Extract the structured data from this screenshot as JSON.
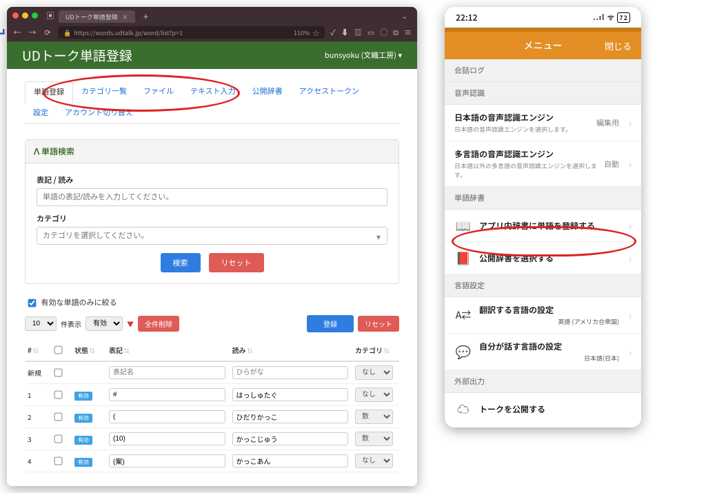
{
  "browser": {
    "tab_title": "UDトーク単語登録",
    "url": "https://words.udtalk.jp/word/list?p=1",
    "zoom": "110%",
    "banner_title": "UDトーク単語登録",
    "user_label": "bunsyoku (文織工房) ▾",
    "nav": {
      "word_reg": "単語登録",
      "categories": "カテゴリ一覧",
      "file": "ファイル",
      "text_input": "テキスト入力",
      "public_dict": "公開辞書",
      "access_token": "アクセストークン",
      "settings": "設定",
      "switch_account": "アカウント切り替え"
    },
    "search_panel": {
      "header": "単語検索",
      "label_notation": "表記 / 読み",
      "ph_notation": "単語の表記/読みを入力してください。",
      "label_category": "カテゴリ",
      "ph_category": "カテゴリを選択してください。",
      "btn_search": "検索",
      "btn_reset": "リセット"
    },
    "filter_valid": "有効な単語のみに絞る",
    "tbl": {
      "perpage": "10",
      "perpage_label": "件表示",
      "validity": "有効",
      "btn_delete_all": "全件削除",
      "btn_register": "登録",
      "btn_reset": "リセット",
      "cols": {
        "idx": "#",
        "state": "状態",
        "notation": "表記",
        "reading": "読み",
        "category": "カテゴリ"
      },
      "new_label": "新規",
      "ph_notation": "表記名",
      "ph_reading": "ひらがな",
      "cat_none": "なし",
      "cat_number": "数",
      "badge_valid": "有効",
      "rows": [
        {
          "n": "1",
          "notation": "#",
          "reading": "はっしゅたぐ",
          "cat": "なし"
        },
        {
          "n": "2",
          "notation": "(",
          "reading": "ひだりかっこ",
          "cat": "数"
        },
        {
          "n": "3",
          "notation": "(10)",
          "reading": "かっこじゅう",
          "cat": "数"
        },
        {
          "n": "4",
          "notation": "(案)",
          "reading": "かっこあん",
          "cat": "なし"
        }
      ]
    }
  },
  "phone": {
    "time": "22:12",
    "signal": "..ıl",
    "wifi": "ᯤ",
    "battery": "72",
    "menu_title": "メニュー",
    "close": "閉じる",
    "sec_log": "会話ログ",
    "sec_asr": "音声認識",
    "asr_jp_title": "日本語の音声認識エンジン",
    "asr_jp_sub": "日本語の音声認識エンジンを選択します。",
    "asr_jp_right": "編集用",
    "asr_multi_title": "多言語の音声認識エンジン",
    "asr_multi_sub": "日本語以外の多言語の音声認識エンジンを選択します。",
    "asr_multi_right": "自動",
    "sec_dict": "単語辞書",
    "dict_register": "アプリ内辞書に単語を登録する",
    "dict_select": "公開辞書を選択する",
    "sec_lang": "言語設定",
    "lang_trans_title": "翻訳する言語の設定",
    "lang_trans_right": "英語 (アメリカ合衆国)",
    "lang_speak_title": "自分が話す言語の設定",
    "lang_speak_right": "日本語(日本)",
    "sec_output": "外部出力",
    "output_row": "トークを公開する"
  }
}
